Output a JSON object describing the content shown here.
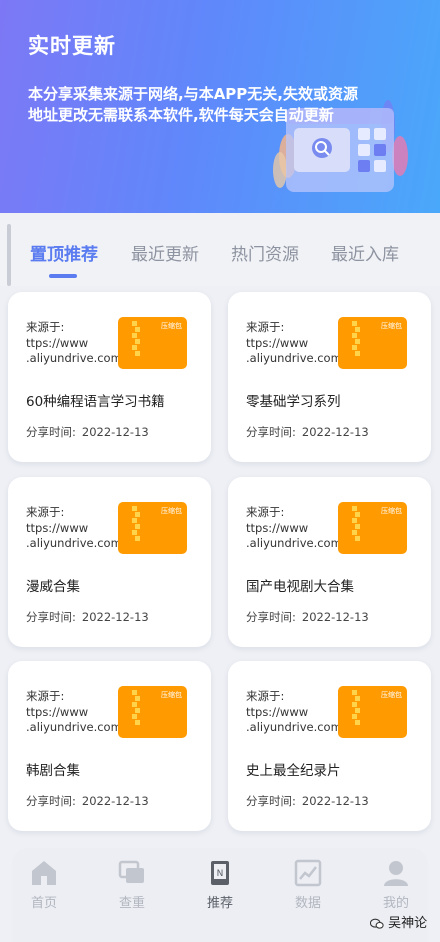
{
  "header": {
    "title": "实时更新",
    "desc": "本分享采集来源于网络,与本APP无关,失效或资源地址更改无需联系本软件,软件每天会自动更新"
  },
  "tabs": [
    {
      "label": "置顶推荐",
      "active": true
    },
    {
      "label": "最近更新",
      "active": false
    },
    {
      "label": "热门资源",
      "active": false
    },
    {
      "label": "最近入库",
      "active": false
    }
  ],
  "zip_label": "压缩包",
  "cards": [
    {
      "source_label": "来源于:",
      "source_url_1": "ttps://www",
      "source_url_2": ".aliyundrive.com",
      "name": "60种编程语言学习书籍",
      "date_label": "分享时间:",
      "date": "2022-12-13"
    },
    {
      "source_label": "来源于:",
      "source_url_1": "ttps://www",
      "source_url_2": ".aliyundrive.com",
      "name": "零基础学习系列",
      "date_label": "分享时间:",
      "date": "2022-12-13"
    },
    {
      "source_label": "来源于:",
      "source_url_1": "ttps://www",
      "source_url_2": ".aliyundrive.com",
      "name": "漫威合集",
      "date_label": "分享时间:",
      "date": "2022-12-13"
    },
    {
      "source_label": "来源于:",
      "source_url_1": "ttps://www",
      "source_url_2": ".aliyundrive.com",
      "name": "国产电视剧大合集",
      "date_label": "分享时间:",
      "date": "2022-12-13"
    },
    {
      "source_label": "来源于:",
      "source_url_1": "ttps://www",
      "source_url_2": ".aliyundrive.com",
      "name": "韩剧合集",
      "date_label": "分享时间:",
      "date": "2022-12-13"
    },
    {
      "source_label": "来源于:",
      "source_url_1": "ttps://www",
      "source_url_2": ".aliyundrive.com",
      "name": "史上最全纪录片",
      "date_label": "分享时间:",
      "date": "2022-12-13"
    }
  ],
  "nav": [
    {
      "label": "首页",
      "icon": "home-icon",
      "active": false
    },
    {
      "label": "查重",
      "icon": "duplicate-icon",
      "active": false
    },
    {
      "label": "推荐",
      "icon": "recommend-icon",
      "active": true
    },
    {
      "label": "数据",
      "icon": "chart-icon",
      "active": false
    },
    {
      "label": "我的",
      "icon": "user-icon",
      "active": false
    }
  ],
  "watermark": "吴神论",
  "colors": {
    "accent": "#5a7cf0",
    "zip": "#ff9a00",
    "header_start": "#7d78f5",
    "header_end": "#4aa8fa"
  }
}
